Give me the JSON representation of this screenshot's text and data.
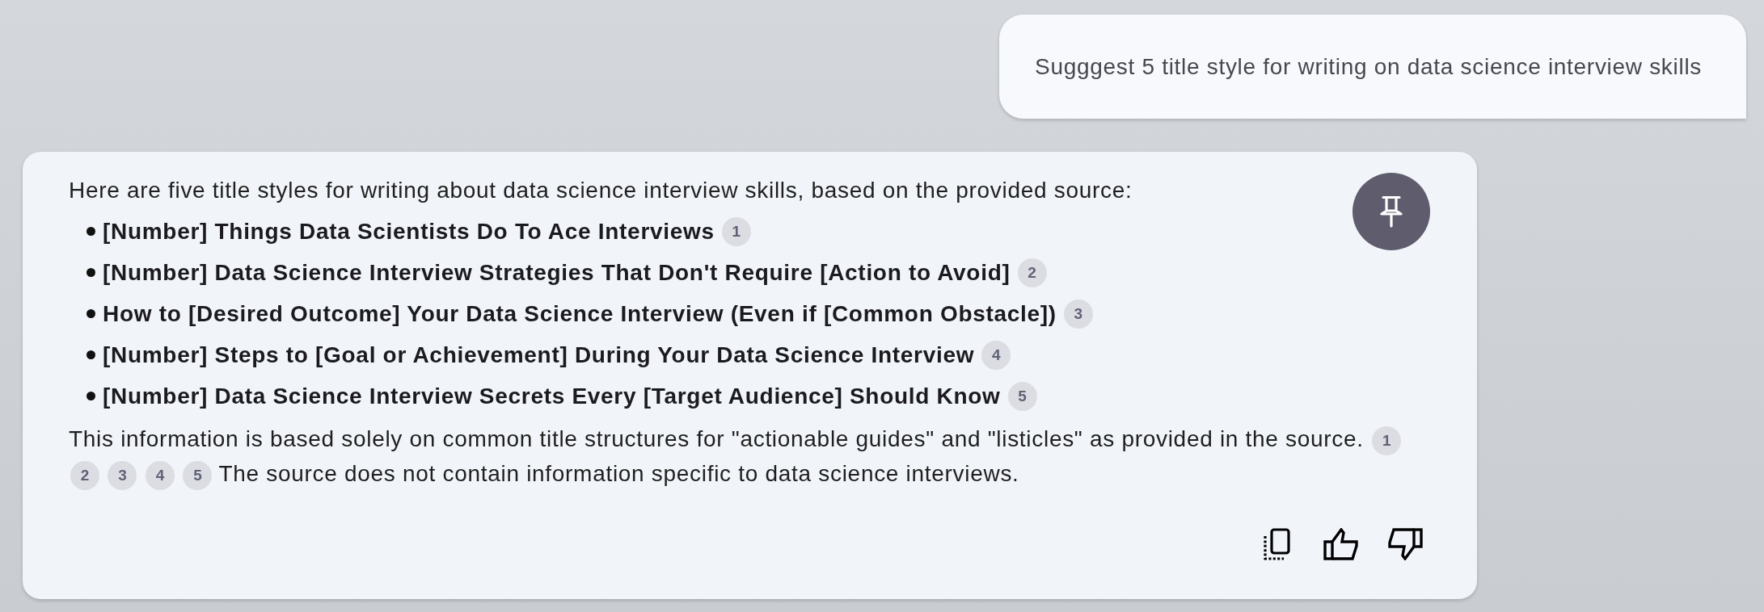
{
  "user_message": {
    "text": "Sugggest 5 title style for writing on data science interview skills"
  },
  "response": {
    "intro": "Here are five title styles for writing about data science interview skills, based on the provided source:",
    "items": [
      {
        "title": "[Number] Things Data Scientists Do To Ace Interviews",
        "citations": [
          "1"
        ]
      },
      {
        "title": "[Number] Data Science Interview Strategies That Don't Require [Action to Avoid]",
        "citations": [
          "2"
        ]
      },
      {
        "title": "How to [Desired Outcome] Your Data Science Interview (Even if [Common Obstacle])",
        "citations": [
          "3"
        ]
      },
      {
        "title": "[Number] Steps to [Goal or Achievement] During Your Data Science Interview",
        "citations": [
          "4"
        ]
      },
      {
        "title": "[Number] Data Science Interview Secrets Every [Target Audience] Should Know",
        "citations": [
          "5"
        ]
      }
    ],
    "closing": [
      {
        "kind": "text",
        "text": "This information is based solely on common title structures for \"actionable guides\" and \"listicles\" as provided in the source."
      },
      {
        "kind": "citation",
        "label": "1"
      },
      {
        "kind": "citation",
        "label": "2"
      },
      {
        "kind": "citation",
        "label": "3"
      },
      {
        "kind": "citation",
        "label": "4"
      },
      {
        "kind": "citation",
        "label": "5"
      },
      {
        "kind": "text",
        "text": "The source does not contain information specific to data science interviews."
      }
    ]
  }
}
